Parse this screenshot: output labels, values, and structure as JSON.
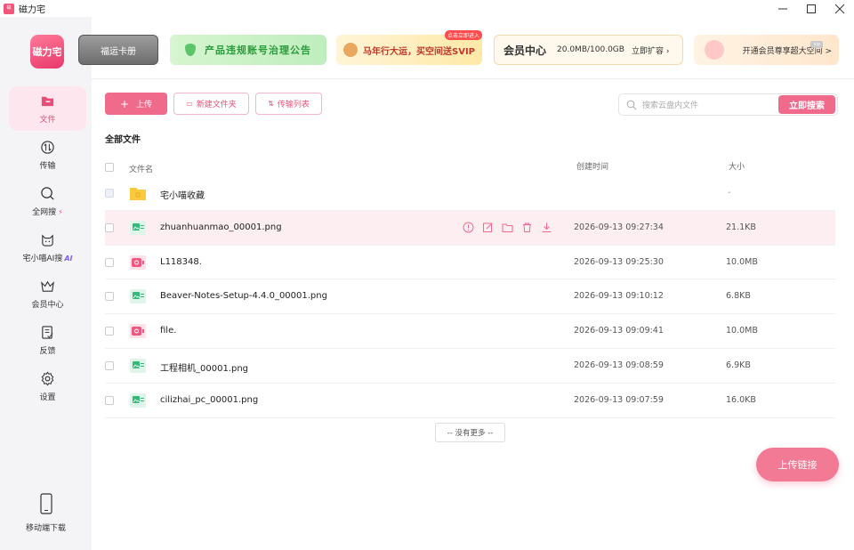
{
  "window": {
    "title": "磁力宅",
    "app_icon_text": "磁力宅"
  },
  "logo": {
    "text": "磁力宅"
  },
  "sidebar": {
    "items": [
      {
        "label": "文件",
        "icon": "file-icon",
        "active": true
      },
      {
        "label": "传输",
        "icon": "transfer-icon",
        "active": false
      },
      {
        "label": "全网搜",
        "icon": "search-icon",
        "badge": "⚡",
        "active": false
      },
      {
        "label": "宅小喵AI搜",
        "icon": "cat-icon",
        "badge": "AI",
        "active": false
      },
      {
        "label": "会员中心",
        "icon": "crown-icon",
        "active": false
      },
      {
        "label": "反馈",
        "icon": "feedback-icon",
        "active": false
      },
      {
        "label": "设置",
        "icon": "gear-icon",
        "active": false
      }
    ],
    "mobile_download": "移动端下载"
  },
  "banners": {
    "fortune_card": "福运卡册",
    "notice": "产品违规账号治理公告",
    "promo": "马年行大运，买空间送SVIP",
    "promo_tag": "点击立即进入",
    "vip_center": "会员中心",
    "capacity": "20.0MB/100.0GB",
    "expand": "立即扩容 ›",
    "open_vip": "开通会员尊享超大空间 >"
  },
  "toolbar": {
    "upload": "上传",
    "new_folder": "新建文件夹",
    "transfer_list": "传输列表"
  },
  "search": {
    "placeholder": "搜索云盘内文件",
    "button": "立即搜索"
  },
  "section_title": "全部文件",
  "table": {
    "headers": {
      "name": "文件名",
      "time": "创建时间",
      "size": "大小"
    },
    "rows": [
      {
        "name": "宅小喵收藏",
        "time": "",
        "size": "-",
        "type": "folder"
      },
      {
        "name": "zhuanhuanmao_00001.png",
        "time": "2026-09-13 09:27:34",
        "size": "21.1KB",
        "type": "image",
        "hover": true
      },
      {
        "name": "L118348.",
        "time": "2026-09-13 09:25:30",
        "size": "10.0MB",
        "type": "video"
      },
      {
        "name": "Beaver-Notes-Setup-4.4.0_00001.png",
        "time": "2026-09-13 09:10:12",
        "size": "6.8KB",
        "type": "image"
      },
      {
        "name": "file.",
        "time": "2026-09-13 09:09:41",
        "size": "10.0MB",
        "type": "video"
      },
      {
        "name": "工程相机_00001.png",
        "time": "2026-09-13 09:08:59",
        "size": "6.9KB",
        "type": "image"
      },
      {
        "name": "cilizhai_pc_00001.png",
        "time": "2026-09-13 09:07:59",
        "size": "16.0KB",
        "type": "image"
      }
    ],
    "no_more": "-- 没有更多 --"
  },
  "upload_link": "上传链接",
  "colors": {
    "accent": "#f06a8c",
    "active_bg": "#fde6ed",
    "active_text": "#e84d77"
  }
}
